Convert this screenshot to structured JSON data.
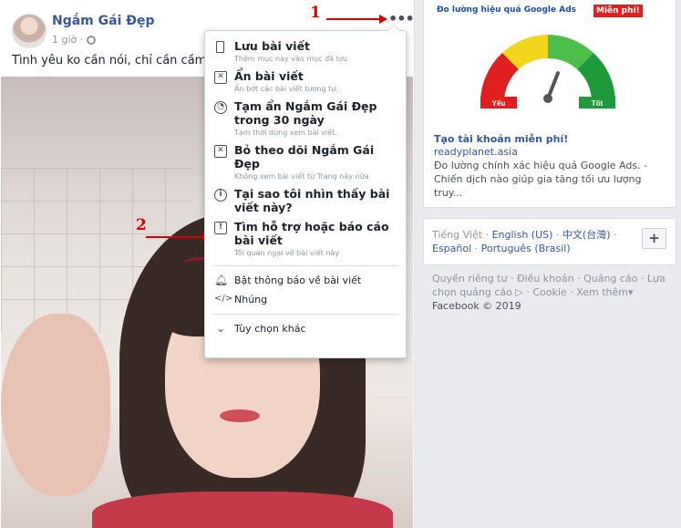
{
  "post": {
    "page_name": "Ngắm Gái Đẹp",
    "time": "1 giờ ·",
    "text": "Tình yêu ko cần nói, chỉ cần cầm nhập",
    "more_label": "•••"
  },
  "annotations": [
    {
      "number": "1"
    },
    {
      "number": "2"
    }
  ],
  "menu": {
    "items": [
      {
        "title": "Lưu bài viết",
        "subtitle": "Thêm mục này vào mục đã lưu",
        "icon": "bookmark-icon"
      },
      {
        "title": "Ẩn bài viết",
        "subtitle": "Ẩn bớt các bài viết tương tự.",
        "icon": "hide-box-icon"
      },
      {
        "title": "Tạm ẩn Ngắm Gái Đẹp trong 30 ngày",
        "subtitle": "Tạm thời dừng xem bài viết.",
        "icon": "clock-icon"
      },
      {
        "title": "Bỏ theo dõi Ngắm Gái Đẹp",
        "subtitle": "Không xem bài viết từ Trang này nữa",
        "icon": "unfollow-icon"
      },
      {
        "title": "Tại sao tôi nhìn thấy bài viết này?",
        "subtitle": "",
        "icon": "info-icon"
      },
      {
        "title": "Tìm hỗ trợ hoặc báo cáo bài viết",
        "subtitle": "Tôi quan ngại về bài viết này",
        "icon": "report-icon"
      }
    ],
    "small_items": [
      {
        "title": "Bật thông báo về bài viết",
        "icon": "bell-icon"
      },
      {
        "title": "Nhúng",
        "icon": "code-icon"
      }
    ],
    "more_options": "Tùy chọn khác"
  },
  "ad": {
    "banner_text": "Đo lường hiệu quả Google Ads",
    "free_badge": "Miễn phí!",
    "gauge_low": "Yếu",
    "gauge_high": "Tốt",
    "title": "Tạo tài khoản miễn phí!",
    "domain": "readyplanet.asia",
    "description": "Đo lường chính xác hiệu quả Google Ads. - Chiến dịch nào giúp gia tăng tối ưu lượng truy...",
    "gauge_level_percent": 62
  },
  "languages": {
    "current": "Tiếng Việt",
    "others": [
      "English (US)",
      "中文(台灣)",
      "Español",
      "Português (Brasil)"
    ],
    "add_label": "+"
  },
  "footer": {
    "links": [
      "Quyền riêng tư",
      "Điều khoản",
      "Quảng cáo",
      "Lựa chọn quảng cáo",
      "Cookie",
      "Xem thêm"
    ],
    "copyright": "Facebook © 2019"
  },
  "colors": {
    "link": "#385898",
    "annotation": "#d40000",
    "gauge_red": "#e0201e",
    "gauge_yellow": "#f2d61c",
    "gauge_green_light": "#4cbf4a",
    "gauge_green_dark": "#1e9a3a"
  }
}
